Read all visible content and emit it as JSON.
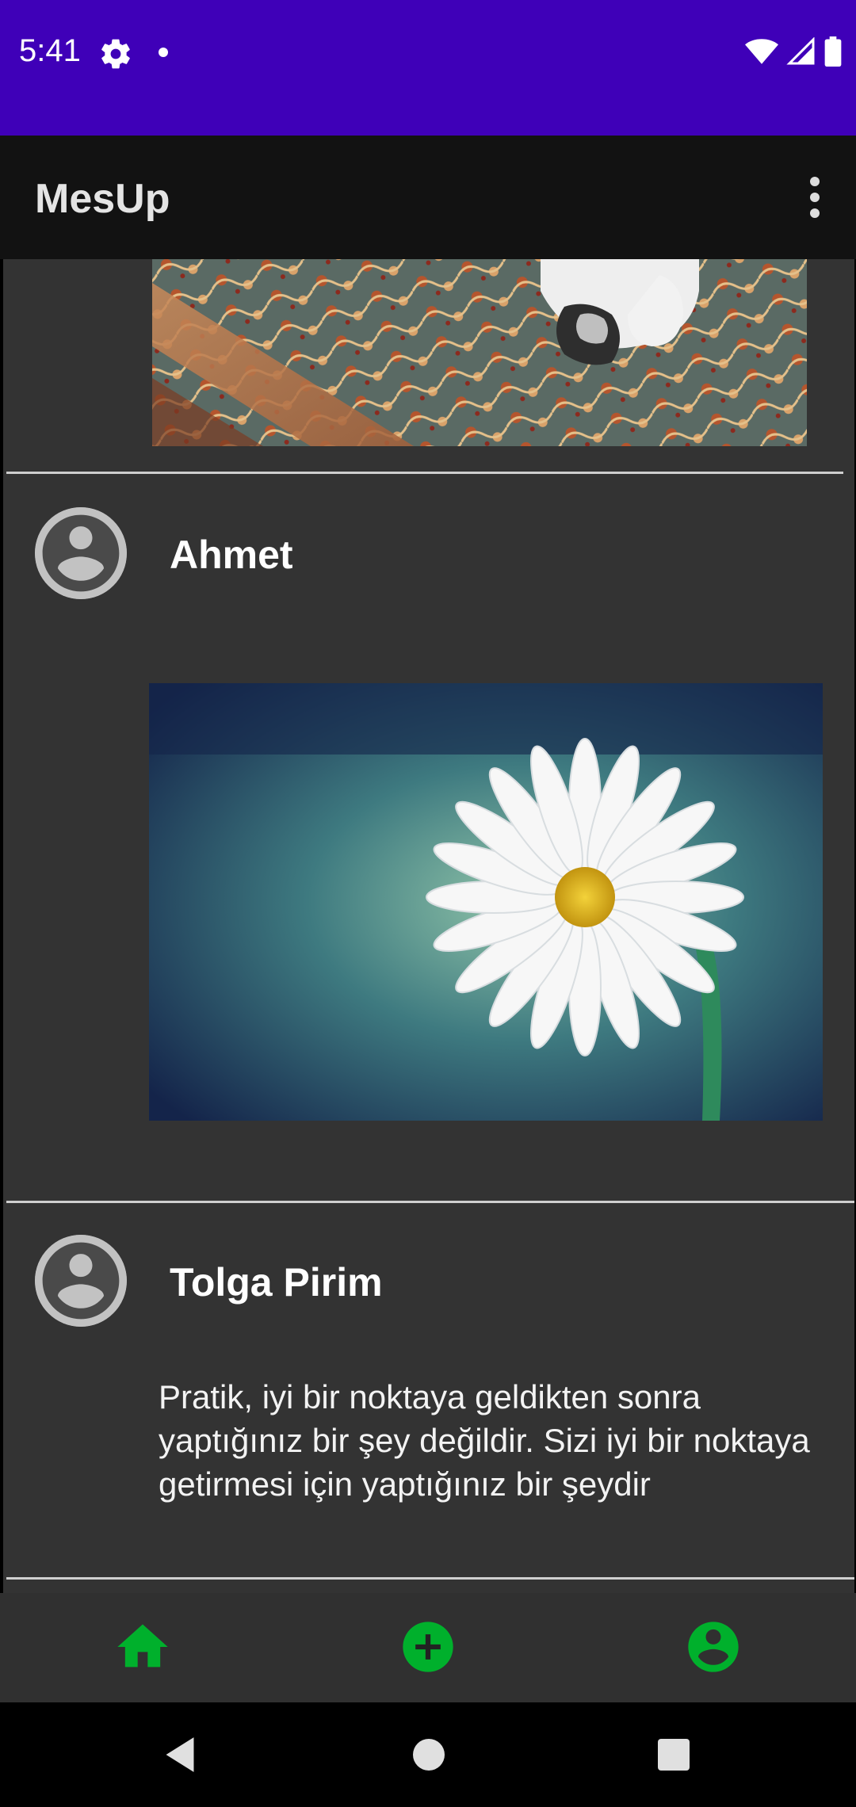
{
  "status_bar": {
    "time": "5:41",
    "icons": [
      "gear-icon",
      "notification-dot",
      "wifi-icon",
      "signal-icon",
      "battery-icon"
    ],
    "background": "#3f00b8"
  },
  "app_bar": {
    "title": "MesUp",
    "menu_icon": "more-vert-icon"
  },
  "feed": {
    "posts": [
      {
        "type": "image",
        "image": "carpet-prayer-photo"
      },
      {
        "author": "Ahmet",
        "avatar": "account-circle-icon",
        "type": "image",
        "image": "daisy-flower-photo"
      },
      {
        "author": "Tolga Pirim",
        "avatar": "account-circle-icon",
        "type": "text",
        "text": "Pratik, iyi bir noktaya geldikten sonra yaptığınız bir şey değildir. Sizi iyi bir noktaya getirmesi için yaptığınız bir şeydir"
      }
    ]
  },
  "bottom_nav": {
    "items": [
      {
        "icon": "home-icon",
        "color": "#00b02c"
      },
      {
        "icon": "add-circle-icon",
        "color": "#00b02c"
      },
      {
        "icon": "account-circle-icon",
        "color": "#00b02c"
      }
    ]
  },
  "system_nav": {
    "items": [
      "back-icon",
      "home-circle-icon",
      "recents-icon"
    ]
  }
}
